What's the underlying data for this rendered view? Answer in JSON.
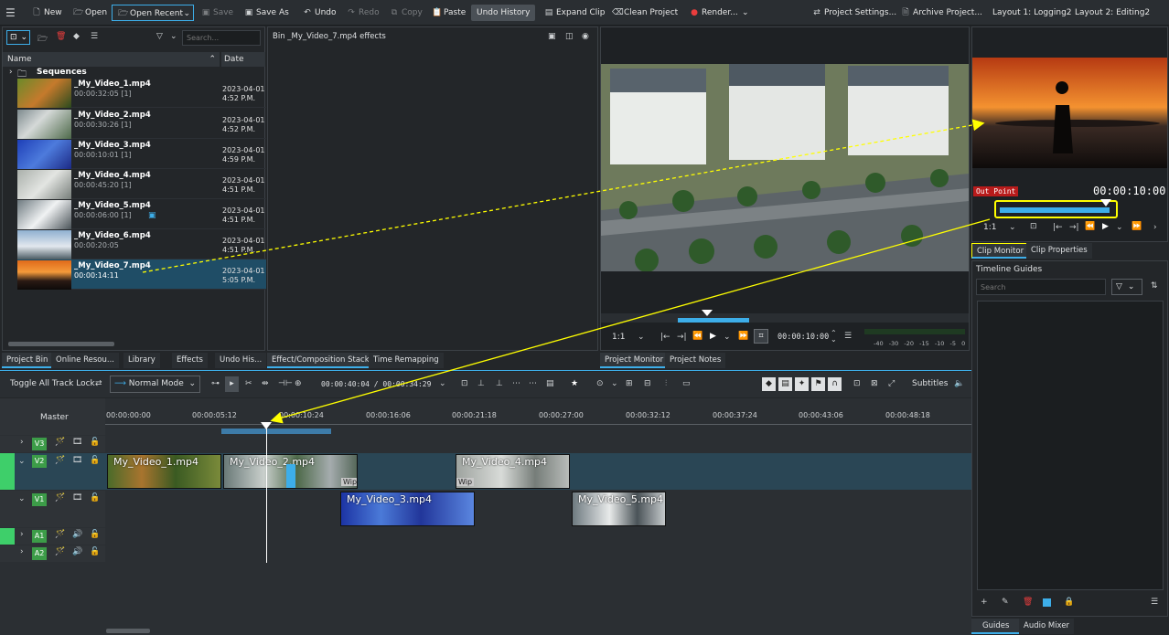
{
  "toolbar": {
    "menu_icon": "hamburger-icon",
    "new": "New",
    "open": "Open",
    "open_recent": "Open Recent",
    "save": "Save",
    "save_as": "Save As",
    "undo": "Undo",
    "redo": "Redo",
    "copy": "Copy",
    "paste": "Paste",
    "undo_history": "Undo History",
    "expand_clip": "Expand Clip",
    "clean_project": "Clean Project",
    "render": "Render...",
    "project_settings": "Project Settings...",
    "archive_project": "Archive Project...",
    "layout1": "Layout 1: Logging2",
    "layout2": "Layout 2: Editing2"
  },
  "bin": {
    "search_placeholder": "Search...",
    "col_name": "Name",
    "col_date": "Date",
    "folder": "Sequences",
    "clips": [
      {
        "name": "_My_Video_1.mp4",
        "dur": "00:00:32:05 [1]",
        "date1": "2023-04-01",
        "date2": "4:52 P.M."
      },
      {
        "name": "_My_Video_2.mp4",
        "dur": "00:00:30:26 [1]",
        "date1": "2023-04-01",
        "date2": "4:52 P.M."
      },
      {
        "name": "_My_Video_3.mp4",
        "dur": "00:00:10:01 [1]",
        "date1": "2023-04-01",
        "date2": "4:59 P.M."
      },
      {
        "name": "_My_Video_4.mp4",
        "dur": "00:00:45:20 [1]",
        "date1": "2023-04-01",
        "date2": "4:51 P.M."
      },
      {
        "name": "_My_Video_5.mp4",
        "dur": "00:00:06:00 [1]",
        "date1": "2023-04-01",
        "date2": "4:51 P.M."
      },
      {
        "name": "_My_Video_6.mp4",
        "dur": "00:00:20:05",
        "date1": "2023-04-01",
        "date2": "4:51 P.M."
      },
      {
        "name": "_My_Video_7.mp4",
        "dur": "00:00:14:11",
        "date1": "2023-04-01",
        "date2": "5:05 P.M."
      }
    ]
  },
  "effects_panel": {
    "title": "Bin _My_Video_7.mp4 effects"
  },
  "left_tabs": [
    "Project Bin",
    "Online Resou...",
    "Library",
    "Effects",
    "Undo His...",
    "Effect/Composition Stack",
    "Time Remapping"
  ],
  "project_monitor": {
    "zoom": "1:1",
    "timecode": "00:00:10:00",
    "tabs": [
      "Project Monitor",
      "Project Notes"
    ],
    "meter_labels": [
      "-40",
      "-30",
      "-20",
      "-15",
      "-10",
      "-5",
      "0"
    ]
  },
  "clip_monitor": {
    "out_point": "Out Point",
    "timecode": "00:00:10:00",
    "zoom": "1:1",
    "tabs": [
      "Clip Monitor",
      "Clip Properties"
    ]
  },
  "guides": {
    "title": "Timeline Guides",
    "search_placeholder": "Search",
    "bottom_tabs": [
      "Guides",
      "Audio Mixer"
    ]
  },
  "timeline_toolbar": {
    "toggle_lock": "Toggle All Track Lock",
    "mode": "Normal Mode",
    "position": "00:00:40:04 / 00:00:34:29",
    "subtitles": "Subtitles"
  },
  "timeline": {
    "master": "Master",
    "ruler": [
      "00:00:00:00",
      "00:00:05:12",
      "00:00:10:24",
      "00:00:16:06",
      "00:00:21:18",
      "00:00:27:00",
      "00:00:32:12",
      "00:00:37:24",
      "00:00:43:06",
      "00:00:48:18"
    ],
    "tracks": [
      "V3",
      "V2",
      "V1",
      "A1",
      "A2"
    ],
    "clips_v2": [
      "My_Video_1.mp4",
      "My_Video_2.mp4",
      "My_Video_4.mp4"
    ],
    "clips_v1": [
      "My_Video_3.mp4",
      "My_Video_5.mp4"
    ],
    "wipe": "Wip"
  },
  "colors": {
    "accent": "#3daee9",
    "track_green": "#3c9c48",
    "annotation": "#ffff00",
    "out_point": "#b81b1b"
  }
}
